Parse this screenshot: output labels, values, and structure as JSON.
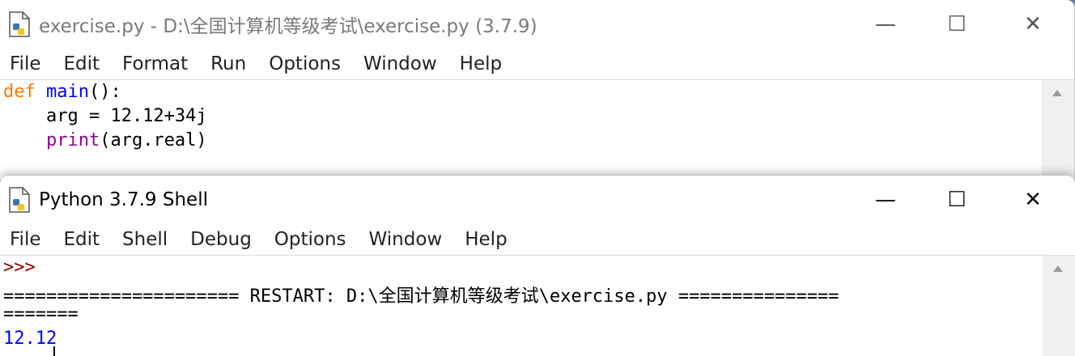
{
  "editor": {
    "title": "exercise.py - D:\\全国计算机等级考试\\exercise.py (3.7.9)",
    "menu": [
      "File",
      "Edit",
      "Format",
      "Run",
      "Options",
      "Window",
      "Help"
    ],
    "code": {
      "line1_kw": "def",
      "line1_name": "main",
      "line1_rest": "():",
      "line2": "    arg = 12.12+34j",
      "line3_indent": "    ",
      "line3_builtin": "print",
      "line3_rest": "(arg.real)"
    }
  },
  "shell": {
    "title": "Python 3.7.9 Shell",
    "menu": [
      "File",
      "Edit",
      "Shell",
      "Debug",
      "Options",
      "Window",
      "Help"
    ],
    "prompt": ">>>",
    "restart_line": "====================== RESTART: D:\\全国计算机等级考试\\exercise.py ===============",
    "restart_wrap": "=======",
    "output": "12.12"
  },
  "window_buttons": {
    "minimize": "—",
    "maximize": "☐",
    "close": "✕"
  },
  "colors": {
    "keyword": "#ff7700",
    "definition": "#0000ff",
    "builtin": "#900090",
    "prompt": "#8b0000",
    "stdout": "#0000ff"
  }
}
